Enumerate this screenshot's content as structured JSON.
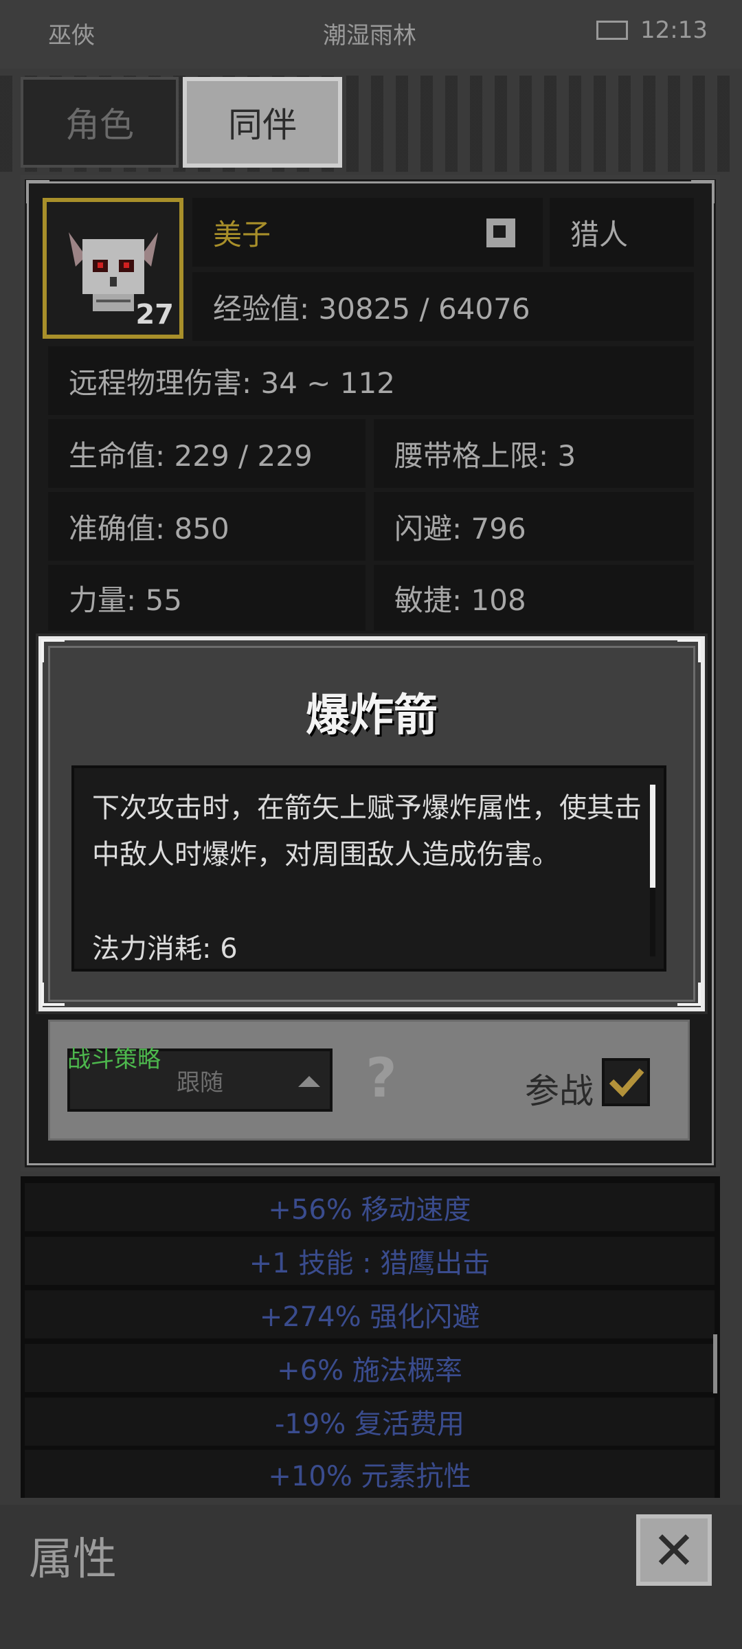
{
  "status_bar": {
    "left": "巫俠",
    "center": "潮湿雨林",
    "time": "12:13"
  },
  "tabs": [
    {
      "label": "角色",
      "active": false
    },
    {
      "label": "同伴",
      "active": true
    }
  ],
  "companion": {
    "name": "美子",
    "class": "猎人",
    "level": "27",
    "experience": "经验值: 30825 / 64076",
    "stats": {
      "ranged_damage": "远程物理伤害: 34 ~ 112",
      "hp": "生命值: 229 / 229",
      "belt_limit": "腰带格上限: 3",
      "accuracy": "准确值: 850",
      "evasion": "闪避: 796",
      "strength": "力量: 55",
      "agility": "敏捷: 108"
    }
  },
  "skill_popup": {
    "title": "爆炸箭",
    "description": "下次攻击时，在箭矢上赋予爆炸属性，使其击中敌人时爆炸，对周围敌人造成伤害。",
    "mana_cost": "法力消耗: 6"
  },
  "strategy": {
    "label": "战斗策略",
    "selected": "跟随",
    "help": "?",
    "join_label": "参战",
    "join_checked": true
  },
  "bonuses": [
    "+56% 移动速度",
    "+1 技能 : 猎鹰出击",
    "+274% 强化闪避",
    "+6% 施法概率",
    "-19% 复活费用",
    "+10% 元素抗性"
  ],
  "bottom": {
    "title": "属性",
    "close": "✕"
  },
  "colors": {
    "gold": "#a88f2a",
    "bonus_blue": "#3a4c8e",
    "strategy_green": "#4db84d"
  }
}
